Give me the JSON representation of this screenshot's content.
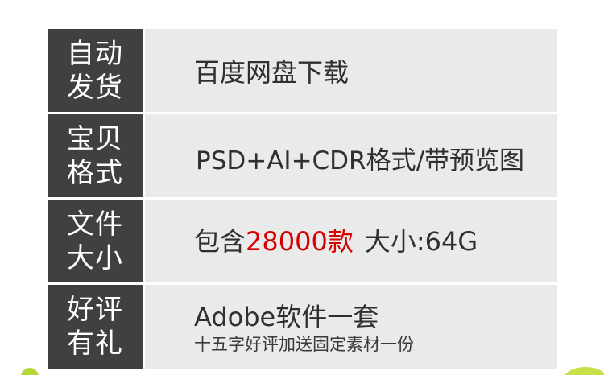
{
  "rows": [
    {
      "label_line1": "自动",
      "label_line2": "发货",
      "value": "百度网盘下载"
    },
    {
      "label_line1": "宝贝",
      "label_line2": "格式",
      "value": "PSD+AI+CDR格式/带预览图"
    },
    {
      "label_line1": "文件",
      "label_line2": "大小",
      "value_prefix": "包含",
      "value_highlight": "28000款",
      "value_suffix": "大小:64G"
    },
    {
      "label_line1": "好评",
      "label_line2": "有礼",
      "value": "Adobe软件一套",
      "value_sub": "十五字好评加送固定素材一份"
    }
  ],
  "colors": {
    "label_bg": "#404040",
    "value_bg": "#eaeaea",
    "highlight": "#d40000",
    "decoration": "#b5d637"
  }
}
